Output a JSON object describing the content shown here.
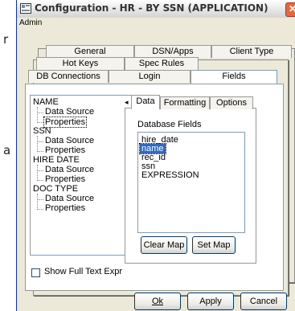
{
  "background_chars": [
    "r",
    "a"
  ],
  "window": {
    "title": "Configuration - HR - BY SSN (APPLICATION)",
    "close_glyph": "✕"
  },
  "menu": {
    "admin_label": "Admin"
  },
  "tabs": {
    "row1": [
      "General",
      "DSN/Apps",
      "Client Type"
    ],
    "row2": [
      "Hot Keys",
      "Spec Rules"
    ],
    "row3": [
      "DB Connections",
      "Login",
      "Fields"
    ]
  },
  "tree": {
    "items": [
      {
        "label": "NAME",
        "level": 0
      },
      {
        "label": "Data Source",
        "level": 1
      },
      {
        "label": "Properties",
        "level": 1,
        "selected": true
      },
      {
        "label": "SSN",
        "level": 0
      },
      {
        "label": "Data Source",
        "level": 1
      },
      {
        "label": "Properties",
        "level": 1
      },
      {
        "label": "HIRE DATE",
        "level": 0
      },
      {
        "label": "Data Source",
        "level": 1
      },
      {
        "label": "Properties",
        "level": 1
      },
      {
        "label": "DOC TYPE",
        "level": 0
      },
      {
        "label": "Data Source",
        "level": 1
      },
      {
        "label": "Properties",
        "level": 1
      }
    ]
  },
  "fulltext_checkbox": {
    "label": "Show Full Text Expr",
    "checked": false
  },
  "subtabs": [
    "Data",
    "Formatting",
    "Options"
  ],
  "database_fields": {
    "label": "Database Fields",
    "items": [
      "hire_date",
      "name",
      "rec_id",
      "ssn",
      "EXPRESSION"
    ],
    "selected_index": 1
  },
  "buttons": {
    "clear_map": "Clear Map",
    "set_map": "Set Map",
    "ok": "Ok",
    "apply": "Apply",
    "cancel": "Cancel"
  },
  "colors": {
    "selection": "#316ac5",
    "dialog_bg": "#ece9d8",
    "close_button": "#e8663c"
  }
}
